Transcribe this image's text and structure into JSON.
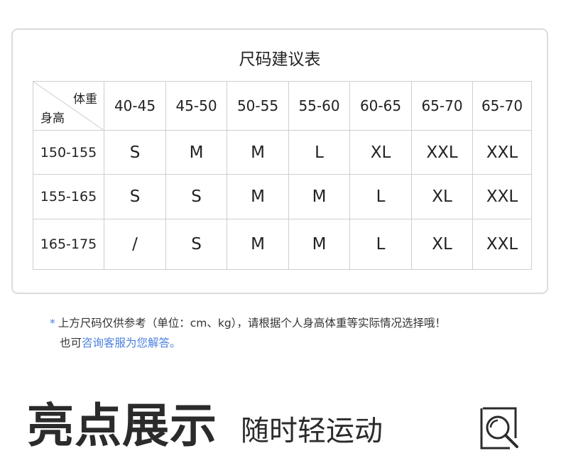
{
  "card": {
    "title": "尺码建议表",
    "corner_weight": "体重",
    "corner_height": "身高",
    "columns": [
      "40-45",
      "45-50",
      "50-55",
      "55-60",
      "60-65",
      "65-70",
      "65-70"
    ],
    "rows": [
      {
        "height": "150-155",
        "values": [
          "S",
          "M",
          "M",
          "L",
          "XL",
          "XXL",
          "XXL"
        ]
      },
      {
        "height": "155-165",
        "values": [
          "S",
          "S",
          "M",
          "M",
          "L",
          "XL",
          "XXL"
        ]
      },
      {
        "height": "165-175",
        "values": [
          "/",
          "S",
          "M",
          "M",
          "L",
          "XL",
          "XXL"
        ]
      }
    ]
  },
  "note": {
    "star": "*",
    "line1": "上方尺码仅供参考（单位：cm、kg），请根据个人身高体重等实际情况选择哦！",
    "line2_prefix": "也可",
    "line2_link": "咨询客服为您解答。"
  },
  "highlight": {
    "title": "亮点展示",
    "subtitle": "随时轻运动",
    "icon": "magnifier-icon"
  },
  "colors": {
    "accent": "#4a7fe0",
    "border": "#cfcfcf",
    "card_border": "#dcdcdc",
    "text": "#222222"
  }
}
